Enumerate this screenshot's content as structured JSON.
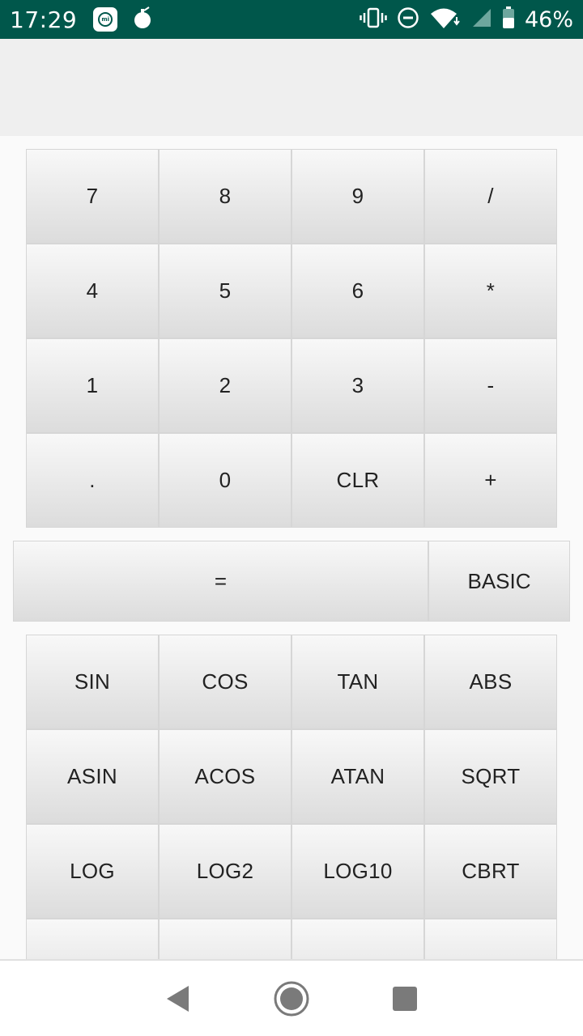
{
  "status_bar": {
    "time": "17:29",
    "battery_percent": "46%",
    "background_color": "#00574b",
    "icons": [
      "mi-app-icon",
      "grenade-icon",
      "vibrate-icon",
      "do-not-disturb-icon",
      "wifi-icon",
      "signal-icon",
      "battery-icon"
    ]
  },
  "display": {
    "value": ""
  },
  "basic_keys": [
    {
      "label": "7",
      "name": "key-7"
    },
    {
      "label": "8",
      "name": "key-8"
    },
    {
      "label": "9",
      "name": "key-9"
    },
    {
      "label": "/",
      "name": "key-divide"
    },
    {
      "label": "4",
      "name": "key-4"
    },
    {
      "label": "5",
      "name": "key-5"
    },
    {
      "label": "6",
      "name": "key-6"
    },
    {
      "label": "*",
      "name": "key-multiply"
    },
    {
      "label": "1",
      "name": "key-1"
    },
    {
      "label": "2",
      "name": "key-2"
    },
    {
      "label": "3",
      "name": "key-3"
    },
    {
      "label": "-",
      "name": "key-subtract"
    },
    {
      "label": ".",
      "name": "key-decimal"
    },
    {
      "label": "0",
      "name": "key-0"
    },
    {
      "label": "CLR",
      "name": "key-clear"
    },
    {
      "label": "+",
      "name": "key-add"
    }
  ],
  "equals_row": {
    "equals_label": "=",
    "mode_label": "BASIC"
  },
  "scientific_keys": [
    {
      "label": "SIN",
      "name": "key-sin"
    },
    {
      "label": "COS",
      "name": "key-cos"
    },
    {
      "label": "TAN",
      "name": "key-tan"
    },
    {
      "label": "ABS",
      "name": "key-abs"
    },
    {
      "label": "ASIN",
      "name": "key-asin"
    },
    {
      "label": "ACOS",
      "name": "key-acos"
    },
    {
      "label": "ATAN",
      "name": "key-atan"
    },
    {
      "label": "SQRT",
      "name": "key-sqrt"
    },
    {
      "label": "LOG",
      "name": "key-log"
    },
    {
      "label": "LOG2",
      "name": "key-log2"
    },
    {
      "label": "LOG10",
      "name": "key-log10"
    },
    {
      "label": "CBRT",
      "name": "key-cbrt"
    },
    {
      "label": "",
      "name": "key-partial-1"
    },
    {
      "label": "",
      "name": "key-partial-2"
    },
    {
      "label": "",
      "name": "key-partial-3"
    },
    {
      "label": "",
      "name": "key-partial-4"
    }
  ],
  "nav_bar": {
    "buttons": [
      "back-icon",
      "home-icon",
      "recents-icon"
    ]
  }
}
